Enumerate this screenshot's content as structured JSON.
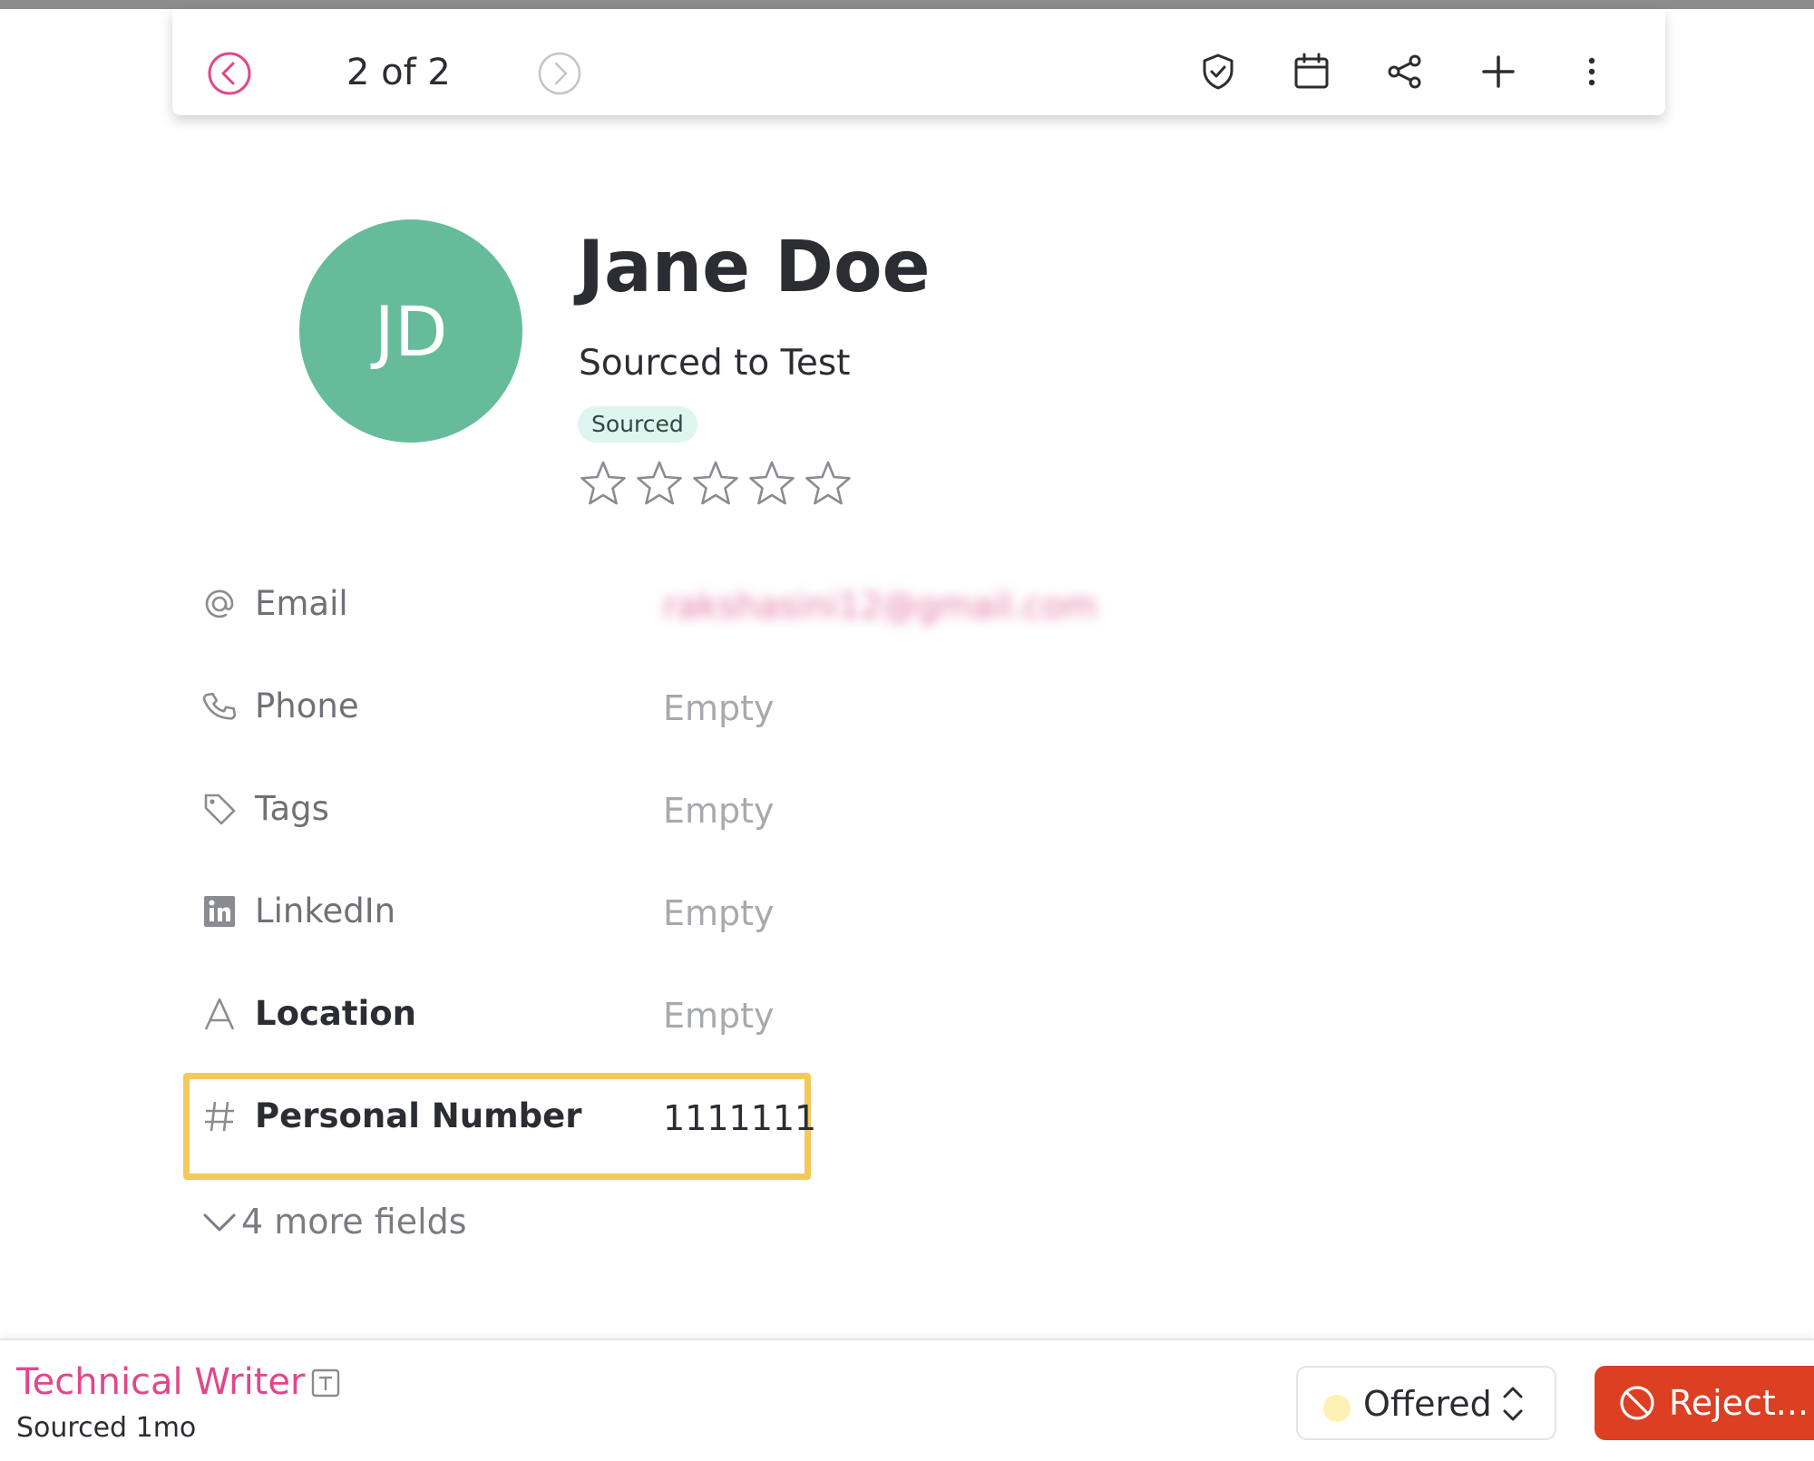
{
  "toolbar": {
    "counter": "2 of 2",
    "icons": [
      "chevron-left-circle-icon",
      "chevron-right-circle-icon",
      "shield-check-icon",
      "calendar-icon",
      "share-icon",
      "plus-icon",
      "more-vertical-icon"
    ]
  },
  "candidate": {
    "initials": "JD",
    "name": "Jane Doe",
    "subtitle": "Sourced to Test",
    "badge": "Sourced",
    "rating": 0,
    "rating_max": 5
  },
  "fields": [
    {
      "label": "Email",
      "value": "rakshasini12@gmail.com",
      "icon": "at-icon"
    },
    {
      "label": "Phone",
      "value": "Empty",
      "icon": "phone-icon"
    },
    {
      "label": "Tags",
      "value": "Empty",
      "icon": "tag-icon"
    },
    {
      "label": "LinkedIn",
      "value": "Empty",
      "icon": "linkedin-icon"
    },
    {
      "label": "Location",
      "value": "Empty",
      "icon": "text-type-icon"
    },
    {
      "label": "Personal Number",
      "value": "1111111",
      "icon": "hash-icon"
    }
  ],
  "more_fields": "4 more fields",
  "footer": {
    "job_title": "Technical Writer",
    "job_sub": "Sourced 1mo",
    "stage": "Offered",
    "reject_label": "Reject..."
  },
  "colors": {
    "accent_pink": "#e0488a",
    "avatar_green": "#66bc9a",
    "reject_red": "#dc3f22",
    "highlight_yellow": "#f6c859",
    "badge_bg": "#dff5ef"
  }
}
